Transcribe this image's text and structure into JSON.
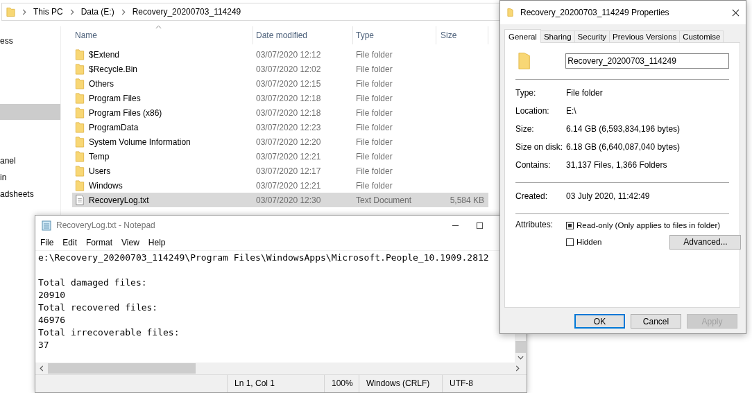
{
  "explorer": {
    "breadcrumb": [
      "This PC",
      "Data (E:)",
      "Recovery_20200703_114249"
    ],
    "sidebar": {
      "items": [
        {
          "label": "ess",
          "selected": false
        },
        {
          "selected": true
        },
        {
          "label": "anel",
          "selected": false
        },
        {
          "label": "in",
          "selected": false
        },
        {
          "label": "adsheets",
          "selected": false
        }
      ]
    },
    "table": {
      "columns": [
        {
          "label": "Name",
          "sorted": true
        },
        {
          "label": "Date modified",
          "sorted": false
        },
        {
          "label": "Type",
          "sorted": false
        },
        {
          "label": "Size",
          "sorted": false
        }
      ],
      "rows": [
        {
          "kind": "folder",
          "name": "$Extend",
          "date": "03/07/2020 12:12",
          "type": "File folder",
          "selected": false
        },
        {
          "kind": "folder",
          "name": "$Recycle.Bin",
          "date": "03/07/2020 12:02",
          "type": "File folder",
          "selected": false
        },
        {
          "kind": "folder",
          "name": "Others",
          "date": "03/07/2020 12:15",
          "type": "File folder",
          "selected": false
        },
        {
          "kind": "folder",
          "name": "Program Files",
          "date": "03/07/2020 12:18",
          "type": "File folder",
          "selected": false
        },
        {
          "kind": "folder",
          "name": "Program Files (x86)",
          "date": "03/07/2020 12:18",
          "type": "File folder",
          "selected": false
        },
        {
          "kind": "folder",
          "name": "ProgramData",
          "date": "03/07/2020 12:23",
          "type": "File folder",
          "selected": false
        },
        {
          "kind": "folder",
          "name": "System Volume Information",
          "date": "03/07/2020 12:20",
          "type": "File folder",
          "selected": false
        },
        {
          "kind": "folder",
          "name": "Temp",
          "date": "03/07/2020 12:21",
          "type": "File folder",
          "selected": false
        },
        {
          "kind": "folder",
          "name": "Users",
          "date": "03/07/2020 12:17",
          "type": "File folder",
          "selected": false
        },
        {
          "kind": "folder",
          "name": "Windows",
          "date": "03/07/2020 12:21",
          "type": "File folder",
          "selected": false
        },
        {
          "kind": "file",
          "name": "RecoveryLog.txt",
          "date": "03/07/2020 12:30",
          "type": "Text Document",
          "size": "5,584 KB",
          "selected": true
        }
      ]
    }
  },
  "notepad": {
    "title": "RecoveryLog.txt - Notepad",
    "menu": [
      "File",
      "Edit",
      "Format",
      "View",
      "Help"
    ],
    "path_line": "e:\\Recovery_20200703_114249\\Program Files\\WindowsApps\\Microsoft.People_10.1909.2812",
    "lines": [
      "Total damaged files:",
      "20910",
      "Total recovered files:",
      "46976",
      "Total irrecoverable files:",
      "37"
    ],
    "status_bar": [
      "Ln 1, Col 1",
      "100%",
      "Windows (CRLF)",
      "UTF-8"
    ]
  },
  "properties": {
    "title": "Recovery_20200703_114249 Properties",
    "tabs": [
      {
        "label": "General",
        "selected": true
      },
      {
        "label": "Sharing",
        "selected": false
      },
      {
        "label": "Security",
        "selected": false
      },
      {
        "label": "Previous Versions",
        "selected": false
      },
      {
        "label": "Customise",
        "selected": false
      }
    ],
    "name_field": "Recovery_20200703_114249",
    "info": [
      {
        "label": "Type:",
        "value": "File folder"
      },
      {
        "label": "Location:",
        "value": "E:\\"
      },
      {
        "label": "Size:",
        "value": "6.14 GB (6,593,834,196 bytes)"
      },
      {
        "label": "Size on disk:",
        "value": "6.18 GB (6,640,087,040 bytes)"
      },
      {
        "label": "Contains:",
        "value": "31,137 Files, 1,366 Folders"
      }
    ],
    "created": {
      "label": "Created:",
      "value": "03 July 2020, 11:42:49"
    },
    "attributes": {
      "label": "Attributes:",
      "options": [
        {
          "label": "Read-only (Only applies to files in folder)",
          "indeterminate": true
        },
        {
          "label": "Hidden",
          "indeterminate": false
        }
      ],
      "advanced": "Advanced..."
    },
    "buttons": [
      {
        "label": "OK",
        "kind": "default",
        "disabled": false
      },
      {
        "label": "Cancel",
        "kind": "normal",
        "disabled": false
      },
      {
        "label": "Apply",
        "kind": "normal",
        "disabled": true
      }
    ]
  }
}
